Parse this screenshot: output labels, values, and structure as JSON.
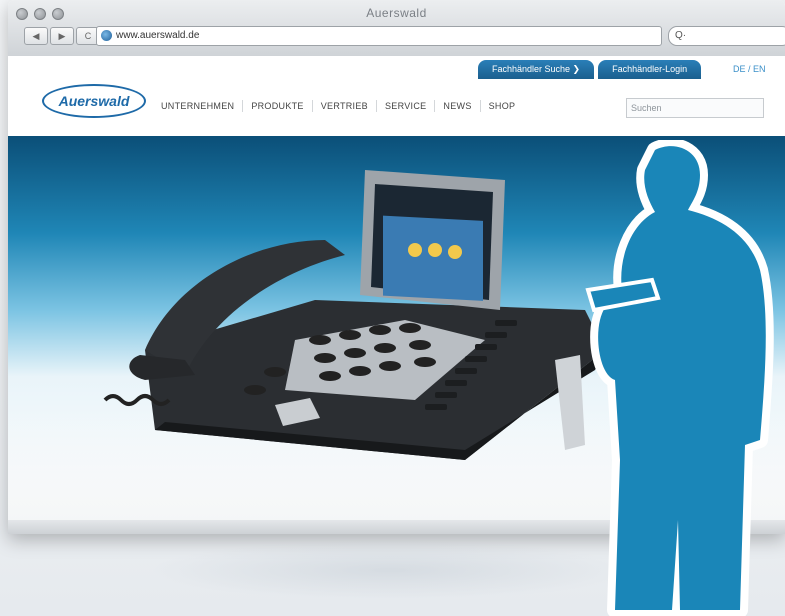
{
  "window": {
    "title": "Auerswald"
  },
  "toolbar": {
    "back": "◀",
    "forward": "▶",
    "reload": "C",
    "url": "www.auerswald.de",
    "search_glyph": "Q·"
  },
  "header": {
    "util_tabs": [
      "Fachhändler Suche ❯",
      "Fachhändler-Login"
    ],
    "lang": "DE / EN",
    "logo": "Auerswald",
    "nav": [
      "UNTERNEHMEN",
      "PRODUKTE",
      "VERTRIEB",
      "SERVICE",
      "NEWS",
      "SHOP"
    ],
    "search_placeholder": "Suchen"
  },
  "colors": {
    "brand_blue": "#1e6aa8",
    "hero_dark": "#0b4f78",
    "silhouette": "#1a86b8"
  }
}
